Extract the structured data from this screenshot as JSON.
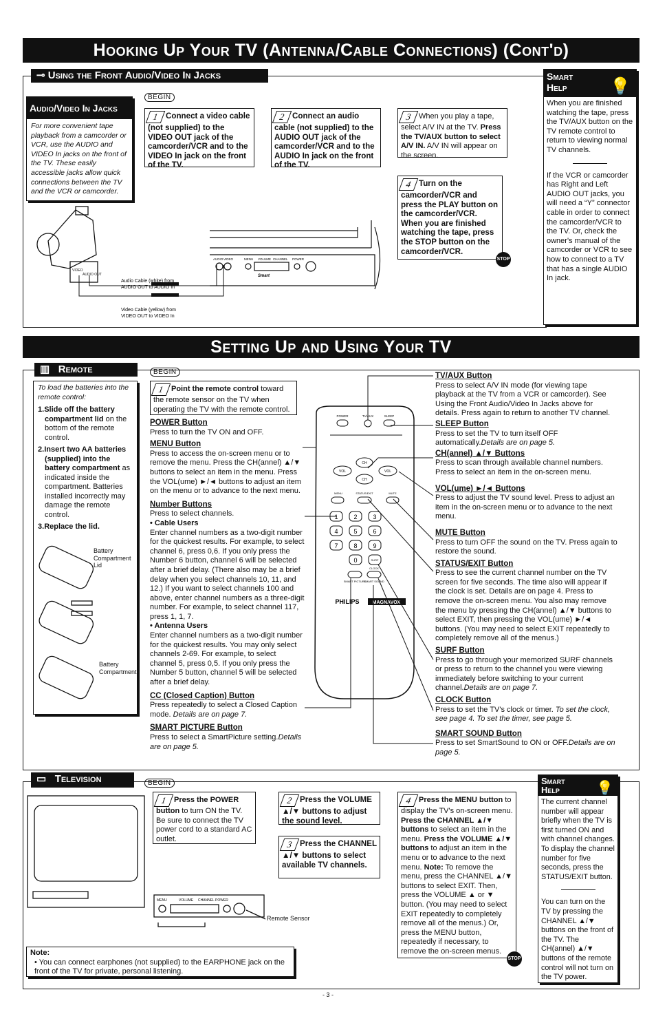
{
  "hookup": {
    "banner": "Hooking Up Your TV (Antenna/Cable Connections) (Cont'd)",
    "section_title": "Using the Front Audio/Video In Jacks",
    "begin": "BEGIN",
    "intro_title": "Audio/Video In Jacks",
    "intro_text": "For more convenient tape playback from a camcorder or VCR, use the AUDIO and VIDEO In jacks on the front of the TV. These easily accessible jacks allow quick connections between the TV and the VCR or camcorder.",
    "steps": [
      {
        "n": "1",
        "runs": [
          {
            "t": "Connect a video cable (not supplied) to the ",
            "s": "b"
          },
          {
            "t": "VIDEO OUT",
            "s": "b"
          },
          {
            "t": " jack of the camcorder/VCR and to the ",
            "s": "b"
          },
          {
            "t": "VIDEO In",
            "s": "b"
          },
          {
            "t": " jack on the front of the TV.",
            "s": "b"
          }
        ]
      },
      {
        "n": "2",
        "runs": [
          {
            "t": "Connect an audio cable (not supplied) to the AUDIO OUT jack of the camcorder/VCR and to the AUDIO In jack on the front of the TV.",
            "s": "b"
          }
        ]
      },
      {
        "n": "3",
        "runs": [
          {
            "t": "When you play a tape, select A/V IN at the TV. ",
            "s": ""
          },
          {
            "t": "Press the TV/AUX button to select A/V IN.",
            "s": "b"
          },
          {
            "t": " A/V IN will appear on the screen.",
            "s": ""
          }
        ]
      },
      {
        "n": "4",
        "runs": [
          {
            "t": "Turn on the camcorder/VCR and press the PLAY button on the camcorder/VCR. When you are finished watching the tape, press the STOP button on the camcorder/VCR.",
            "s": "b"
          }
        ]
      }
    ],
    "stop_label": "STOP",
    "diagram": {
      "audio_cable": "Audio Cable (white) from",
      "audio_cable2": "AUDIO OUT to AUDIO In",
      "video_cable": "Video Cable (yellow) from",
      "video_cable2": "VIDEO OUT to VIDEO In",
      "jack_labels": [
        "AUDIO",
        "VIDEO",
        "MENU",
        "VOLUME",
        "CHANNEL",
        "POWER"
      ],
      "cam_jacks": [
        "VIDEO",
        "AUDIO OUT"
      ],
      "tv_brand": "Smart"
    },
    "smart_help": {
      "title1": "Smart",
      "title2": "Help",
      "p1": "When you are finished watching the tape, press the TV/AUX button on the TV remote control to return to viewing normal TV channels.",
      "p2": "If the VCR or camcorder has Right and Left AUDIO OUT jacks, you will need a “Y” connector cable in order to connect the camcorder/VCR to the TV. Or, check the owner's manual of the camcorder or VCR to see how to connect to a TV that has a single AUDIO In jack."
    }
  },
  "setup": {
    "banner": "Setting Up and Using Your TV",
    "remote": {
      "title": "Remote",
      "begin": "BEGIN",
      "batt_intro": "To load the batteries into the remote control:",
      "batt_steps": [
        {
          "n": "1.",
          "b": "Slide off the battery compartment lid",
          "t": " on the bottom of the remote control."
        },
        {
          "n": "2.",
          "b": "Insert two AA batteries (supplied) into the battery compartment",
          "t": " as indicated inside the compartment. Batteries installed incorrectly may damage the remote control."
        },
        {
          "n": "3.",
          "b": "Replace the lid.",
          "t": ""
        }
      ],
      "batt_labels": {
        "lid": "Battery Compartment Lid",
        "comp": "Battery Compartment"
      },
      "step1_bold": "Point the remote control",
      "step1_text": " toward the remote sensor on the TV when operating the TV with the remote control.",
      "left_items": [
        {
          "h": "POWER Button",
          "t": "Press to turn the TV ON and OFF."
        },
        {
          "h": "MENU Button",
          "t": "Press to access the on-screen menu or to remove the menu. Press the CH(annel) ▲/▼ buttons to select an item in the menu. Press the VOL(ume) ►/◄ buttons to adjust an item on the menu or to advance to the next menu."
        },
        {
          "h": "Number Buttons",
          "t": "Press to select channels.",
          "sub": [
            {
              "h": "• Cable Users",
              "t": "Enter channel numbers as a two-digit number for the quickest results. For example, to select channel 6, press 0,6. If you only press the Number 6 button, channel 6 will be selected after a brief delay. (There also may be a brief delay when you select channels 10, 11, and 12.) If you want to select channels 100 and above, enter channel numbers as a three-digit number. For example, to select channel 117, press 1, 1, 7."
            },
            {
              "h": "• Antenna Users",
              "t": "Enter channel numbers as a two-digit number for the quickest results. You may only select channels 2-69. For example, to select channel 5, press 0,5. If you only press the Number 5 button, channel 5 will be selected after a brief delay."
            }
          ]
        },
        {
          "h": "CC (Closed Caption) Button",
          "t": "Press repeatedly to select a Closed Caption mode.",
          "i": " Details are on page 7."
        },
        {
          "h": "SMART PICTURE Button",
          "t": "Press to select a SmartPicture setting.",
          "i": "Details are on page 5."
        }
      ],
      "right_items": [
        {
          "h": "TV/AUX Button",
          "t": "Press to select A/V IN mode (for viewing tape playback at the TV from a VCR or camcorder). See Using the Front Audio/Video In Jacks above for details. Press again to return to another TV channel.",
          "i": ""
        },
        {
          "h": "SLEEP Button",
          "t": "Press to set the TV to turn itself OFF automatically.",
          "i": "Details are on page 5."
        },
        {
          "h": "CH(annel) ▲/▼ Buttons",
          "t": "Press to scan through available channel numbers. Press to select an item in the on-screen menu.",
          "i": ""
        },
        {
          "h": "VOL(ume) ►/◄ Buttons",
          "t": "Press to adjust the TV sound level. Press to adjust an item in the on-screen menu or to advance to the next menu.",
          "i": ""
        },
        {
          "h": "MUTE Button",
          "t": "Press to turn OFF the sound on the TV. Press again to restore the sound.",
          "i": ""
        },
        {
          "h": "STATUS/EXIT Button",
          "t": "Press to see the current channel number on the TV screen for five seconds. The time also will appear if the clock is set. Details are on page 4. Press to remove the on-screen menu. You also may remove the menu by pressing the CH(annel) ▲/▼ buttons to select EXIT, then pressing the VOL(ume) ►/◄ buttons. (You may need to select EXIT repeatedly to completely remove all of the menus.)",
          "i": ""
        },
        {
          "h": "SURF Button",
          "t": "Press to go through your memorized SURF channels or press to return to the channel you were viewing immediately before switching to your current channel.",
          "i": "Details are on page 7."
        },
        {
          "h": "CLOCK Button",
          "t": "Press to set the TV's clock or timer.",
          "i": " To set the clock, see page 4. To set the timer, see page 5."
        },
        {
          "h": "SMART SOUND Button",
          "t": "Press to set SmartSound to ON or OFF.",
          "i": "Details are on page 5."
        }
      ],
      "remote_labels": {
        "power": "POWER",
        "tvaux": "TV/AUX",
        "sleep": "SLEEP",
        "ch": "CH",
        "vol": "VOL",
        "menu": "MENU",
        "status": "STATUS/EXIT",
        "mute": "MUTE",
        "keys": [
          "1",
          "2",
          "3",
          "4",
          "5",
          "6",
          "7",
          "8",
          "9",
          "0"
        ],
        "surf": "SURF",
        "clock": "CLOCK",
        "cc": "CC",
        "smart_pic": "SMART PICTURE",
        "smart_snd": "SMART SOUND",
        "brand1": "PHILIPS",
        "brand2": "MAGNAVOX"
      }
    },
    "television": {
      "title": "Television",
      "begin": "BEGIN",
      "steps": [
        {
          "n": "1",
          "runs": [
            {
              "t": "Press the POWER button",
              "s": "b"
            },
            {
              "t": " to turn ON the TV. Be sure to connect the TV power cord to a standard AC outlet.",
              "s": ""
            }
          ]
        },
        {
          "n": "2",
          "runs": [
            {
              "t": "Press the VOLUME ▲/▼ buttons to adjust the sound level.",
              "s": "b"
            }
          ]
        },
        {
          "n": "3",
          "runs": [
            {
              "t": "Press the CHANNEL ▲/▼ buttons to select available TV channels.",
              "s": "b"
            }
          ]
        },
        {
          "n": "4",
          "runs": [
            {
              "t": "Press the MENU button",
              "s": "b"
            },
            {
              "t": " to display the TV's on-screen menu. ",
              "s": ""
            },
            {
              "t": "Press the CHANNEL ▲/▼ buttons",
              "s": "b"
            },
            {
              "t": " to select an item in the menu. ",
              "s": ""
            },
            {
              "t": "Press the VOLUME ▲/▼ buttons",
              "s": "b"
            },
            {
              "t": " to adjust an item in the menu or to advance to the next menu. ",
              "s": ""
            },
            {
              "t": "Note:",
              "s": "b"
            },
            {
              "t": " To remove the menu, press the CHANNEL ▲/▼ buttons to select EXIT. Then, press the VOLUME ▲ or ▼ button. (You may need to select EXIT repeatedly to completely remove all of the menus.) Or, press the MENU button, repeatedly if necessary, to remove the on-screen menus.",
              "s": ""
            }
          ]
        }
      ],
      "panel_labels": [
        "MENU",
        "VOLUME",
        "CHANNEL",
        "POWER"
      ],
      "remote_sensor": "Remote Sensor",
      "note_title": "Note:",
      "note_text": "You can connect earphones (not supplied) to the EARPHONE jack on the front of the TV for private, personal listening.",
      "smart_help": {
        "title1": "Smart",
        "title2": "Help",
        "p1": "The current channel number will appear briefly when the TV is first turned ON and with channel changes. To display the channel number for five seconds, press the STATUS/EXIT button.",
        "p2": "You can turn on the TV by pressing the CHANNEL ▲/▼ buttons on the front of the TV. The CH(annel) ▲/▼ buttons of the remote control will not turn on the TV power."
      }
    }
  },
  "page_number": "- 3 -"
}
